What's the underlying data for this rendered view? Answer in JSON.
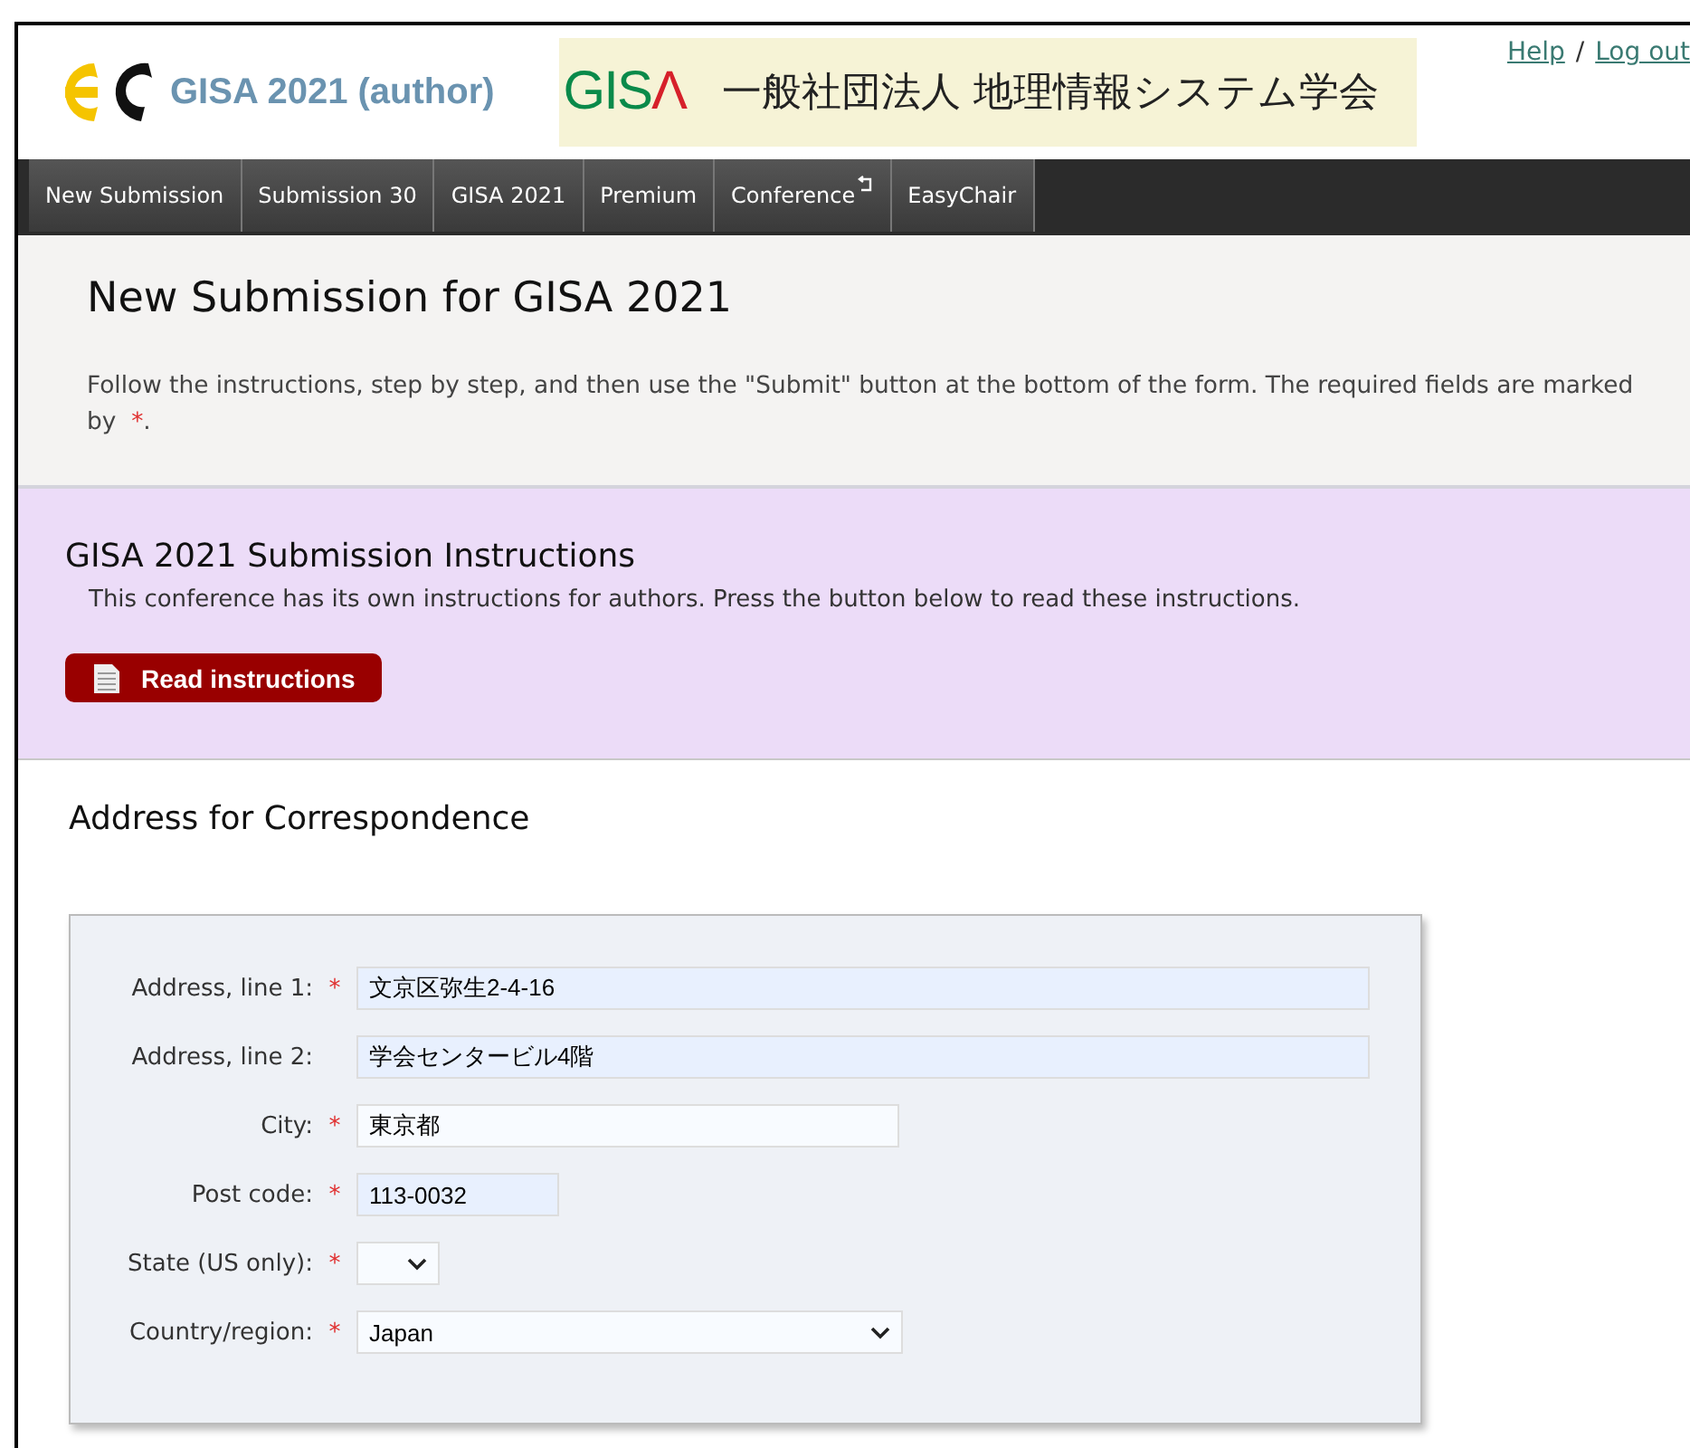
{
  "header": {
    "logo_text": "GISA 2021 (author)",
    "banner": {
      "mark": "GIS",
      "mark_accent": "Λ",
      "name": "一般社団法人 地理情報システム学会"
    },
    "links": [
      "Help",
      "Log out"
    ],
    "separator": "/"
  },
  "nav": [
    {
      "label": "New Submission",
      "external": false
    },
    {
      "label": "Submission 30",
      "external": false
    },
    {
      "label": "GISA 2021",
      "external": false
    },
    {
      "label": "Premium",
      "external": false
    },
    {
      "label": "Conference",
      "external": true
    },
    {
      "label": "EasyChair",
      "external": false
    }
  ],
  "intro": {
    "title": "New Submission for GISA 2021",
    "text": "Follow the instructions, step by step, and then use the \"Submit\" button at the bottom of the form. The required fields are marked by",
    "required_mark": "*",
    "end": "."
  },
  "instructions": {
    "title": "GISA 2021 Submission Instructions",
    "text": "This conference has its own instructions for authors. Press the button below to read these instructions.",
    "button": "Read instructions"
  },
  "address": {
    "title": "Address for Correspondence",
    "fields": [
      {
        "label": "Address, line 1:",
        "required": true,
        "kind": "text",
        "value": "文京区弥生2-4-16",
        "autofilled": true
      },
      {
        "label": "Address, line 2:",
        "required": false,
        "kind": "text",
        "value": "学会センタービル4階",
        "autofilled": true
      },
      {
        "label": "City:",
        "required": true,
        "kind": "text",
        "value": "東京都",
        "autofilled": false
      },
      {
        "label": "Post code:",
        "required": true,
        "kind": "text",
        "value": "113-0032",
        "autofilled": true
      },
      {
        "label": "State (US only):",
        "required": true,
        "kind": "select",
        "autofilled": false
      },
      {
        "label": "Country/region:",
        "required": true,
        "kind": "select",
        "value": "Japan",
        "autofilled": false
      }
    ]
  }
}
